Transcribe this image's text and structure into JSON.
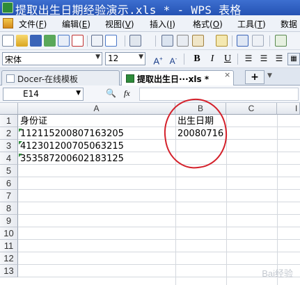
{
  "window": {
    "title": "提取出生日期经验演示.xls * - WPS 表格"
  },
  "menu": {
    "items": [
      {
        "label": "文件(",
        "key": "F",
        "end": ")"
      },
      {
        "label": "编辑(",
        "key": "E",
        "end": ")"
      },
      {
        "label": "视图(",
        "key": "V",
        "end": ")"
      },
      {
        "label": "插入(",
        "key": "I",
        "end": ")"
      },
      {
        "label": "格式(",
        "key": "O",
        "end": ")"
      },
      {
        "label": "工具(",
        "key": "T",
        "end": ")"
      },
      {
        "label": "数据",
        "key": "",
        "end": ""
      }
    ]
  },
  "format_toolbar": {
    "font_name": "宋体",
    "font_size": "12",
    "bold": "B",
    "italic": "I",
    "underline": "U"
  },
  "tabs": [
    {
      "label": "Docer-在线模板",
      "active": false
    },
    {
      "label": "提取出生日···xls *",
      "active": true
    }
  ],
  "formula_bar": {
    "cell_ref": "E14",
    "fx": "fx",
    "content": ""
  },
  "sheet": {
    "columns": [
      "A",
      "B",
      "C",
      "I"
    ],
    "rows": [
      "1",
      "2",
      "3",
      "4",
      "5",
      "6",
      "7",
      "8",
      "9",
      "10",
      "11",
      "12",
      "13"
    ],
    "cells": {
      "A1": "身份证",
      "B1": "出生日期",
      "A2": "112115200807163205",
      "B2": "20080716",
      "A3": "412301200705063215",
      "A4": "353587200602183125"
    }
  },
  "colors": {
    "titlebar": "#2452b3",
    "annotation_circle": "#d4202a",
    "error_indicator": "#2e8b3a"
  },
  "watermark": "Bai经验"
}
